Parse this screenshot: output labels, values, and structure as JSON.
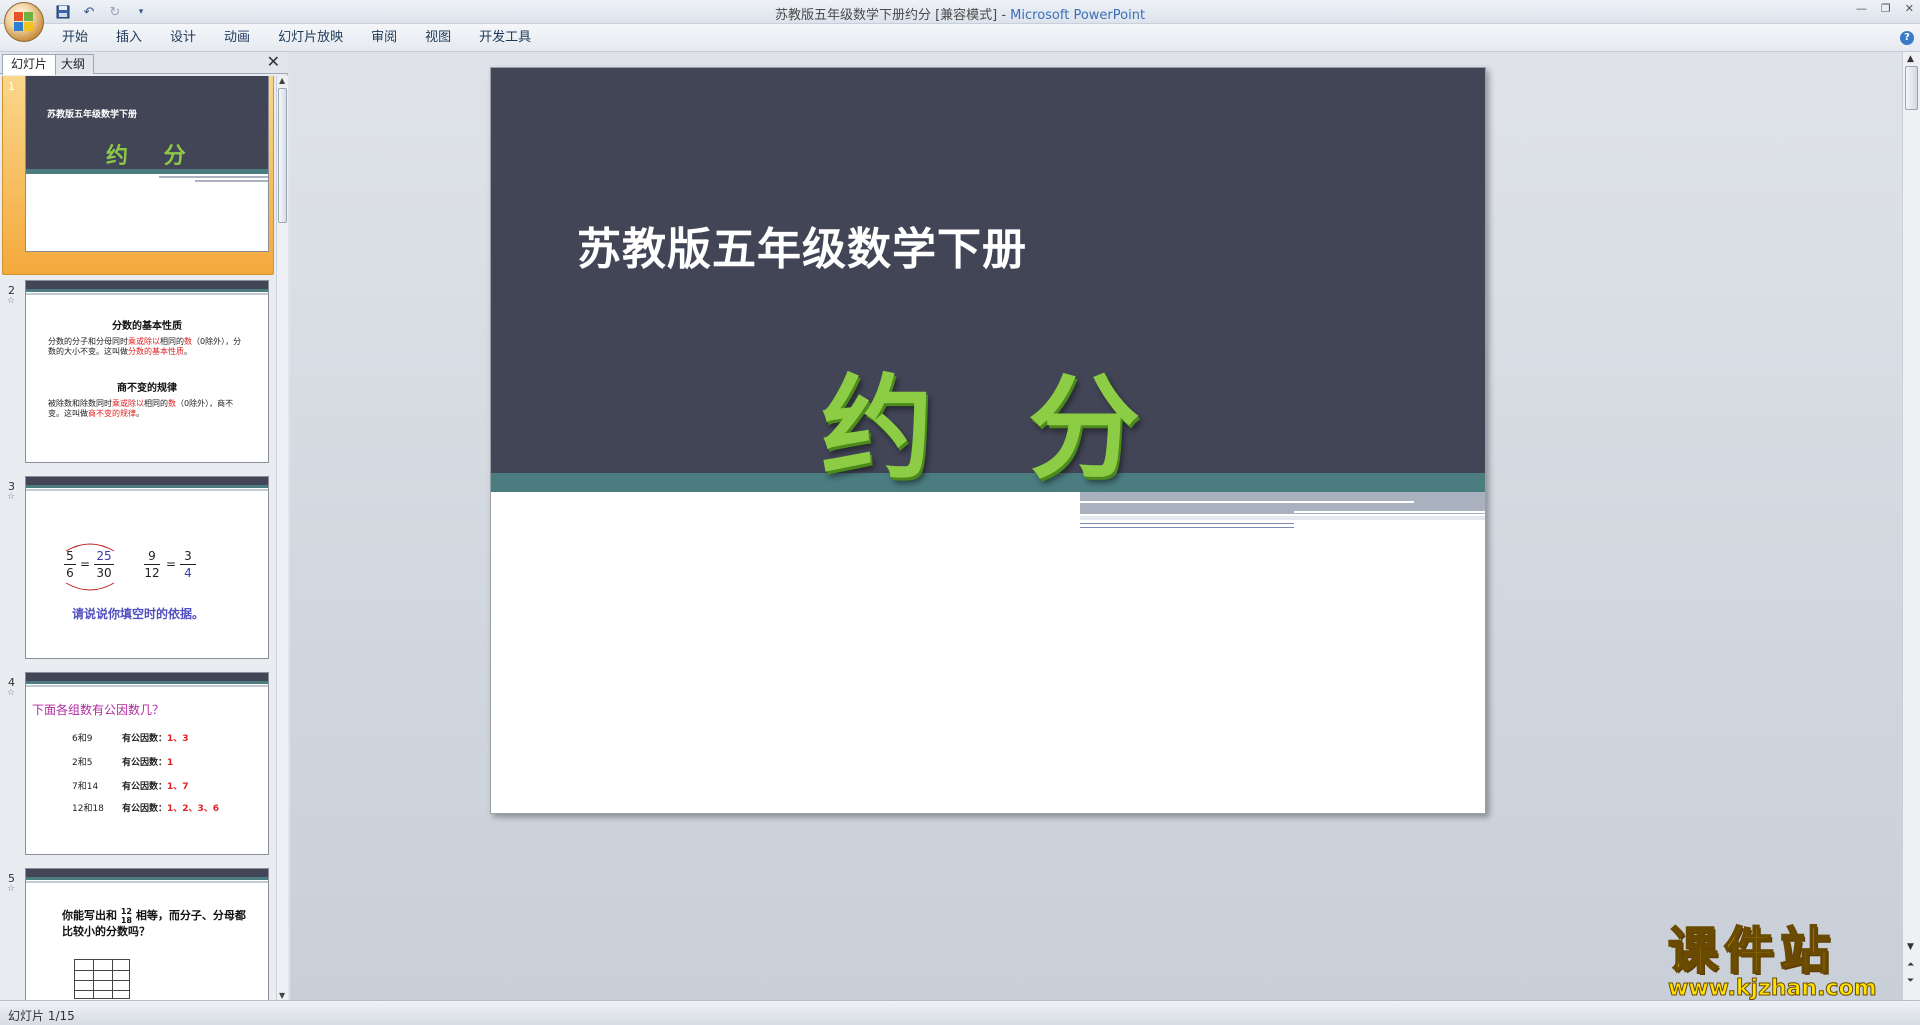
{
  "window": {
    "title_doc": "苏教版五年级数学下册约分 [兼容模式] - ",
    "title_app": "Microsoft PowerPoint"
  },
  "ribbon": {
    "tabs": [
      "开始",
      "插入",
      "设计",
      "动画",
      "幻灯片放映",
      "审阅",
      "视图",
      "开发工具"
    ]
  },
  "panel": {
    "tab_slides": "幻灯片",
    "tab_outline": "大纲"
  },
  "thumbnails": [
    {
      "num": "1",
      "subtitle": "苏教版五年级数学下册",
      "title": "约 分"
    },
    {
      "num": "2",
      "heading1": "分数的基本性质",
      "text1a": "分数的分子和分母同时",
      "text1b": "乘或除以",
      "text1c": "相同的",
      "text1d": "数",
      "text1e": "（0除外），分数的大小不变。这叫做",
      "text1f": "分数的基本性质",
      "text1g": "。",
      "heading2": "商不变的规律",
      "text2a": "被除数和除数同时",
      "text2b": "乘或除以",
      "text2c": "相同的",
      "text2d": "数",
      "text2e": "（0除外），商不变。这叫做",
      "text2f": "商不变的规律",
      "text2g": "。"
    },
    {
      "num": "3",
      "f1n": "5",
      "f1d": "6",
      "f2n": "25",
      "f2d": "30",
      "f3n": "9",
      "f3d": "12",
      "f4n": "3",
      "f4d": "4",
      "eq": "=",
      "question": "请说说你填空时的依据。"
    },
    {
      "num": "4",
      "title": "下面各组数有公因数几？",
      "rows": [
        {
          "pair": "6和9",
          "label": "有公因数：",
          "val": "1、3"
        },
        {
          "pair": "2和5",
          "label": "有公因数：",
          "val": "1"
        },
        {
          "pair": "7和14",
          "label": "有公因数：",
          "val": "1、7"
        },
        {
          "pair": "12和18",
          "label": "有公因数：",
          "val": "1、2、3、6"
        }
      ]
    },
    {
      "num": "5",
      "q_a": "你能写出和",
      "q_fn": "12",
      "q_fd": "18",
      "q_b": "相等，而分子、分母都比较小的分数吗？"
    }
  ],
  "slide": {
    "subtitle": "苏教版五年级数学下册",
    "title": "约分"
  },
  "watermark": {
    "big": "课件站",
    "small": "www.kjzhan.com"
  },
  "status": {
    "text": "幻灯片 1/15"
  },
  "colors": {
    "slide_dark": "#424556",
    "slide_teal": "#4a7c80",
    "title_green": "#8ccd45",
    "selection": "#f4a93c"
  }
}
